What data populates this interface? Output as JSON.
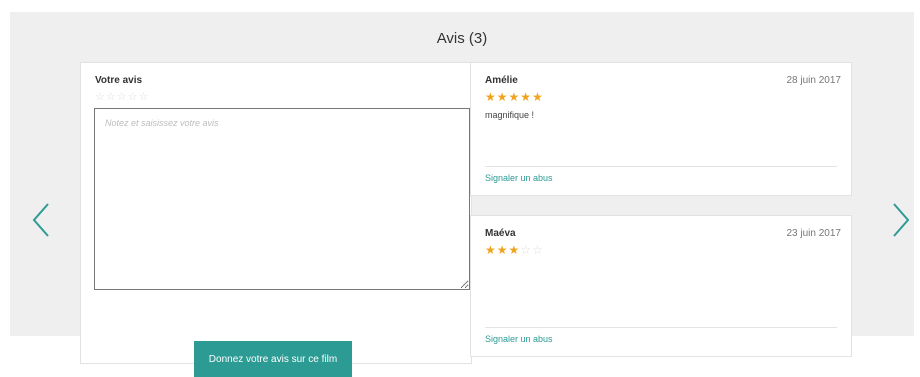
{
  "reviews_section": {
    "title": "Avis (3)"
  },
  "form": {
    "label": "Votre avis",
    "stars_empty": [
      "☆",
      "☆",
      "☆",
      "☆",
      "☆"
    ],
    "textarea_placeholder": "Notez et saisissez votre avis",
    "submit_label": "Donnez votre avis sur ce film"
  },
  "reviews": [
    {
      "author": "Amélie",
      "date": "28 juin 2017",
      "rating": 5,
      "rating_max": 5,
      "text": "magnifique !",
      "report_label": "Signaler un abus"
    },
    {
      "author": "Maéva",
      "date": "23 juin 2017",
      "rating": 3,
      "rating_max": 5,
      "text": "",
      "report_label": "Signaler un abus"
    }
  ],
  "colors": {
    "accent": "#2c9b94",
    "star_filled": "#f0a31f",
    "star_empty": "#dddddd",
    "panel_bg": "#efefef"
  },
  "icons": {
    "prev": "chevron-left-icon",
    "next": "chevron-right-icon"
  }
}
